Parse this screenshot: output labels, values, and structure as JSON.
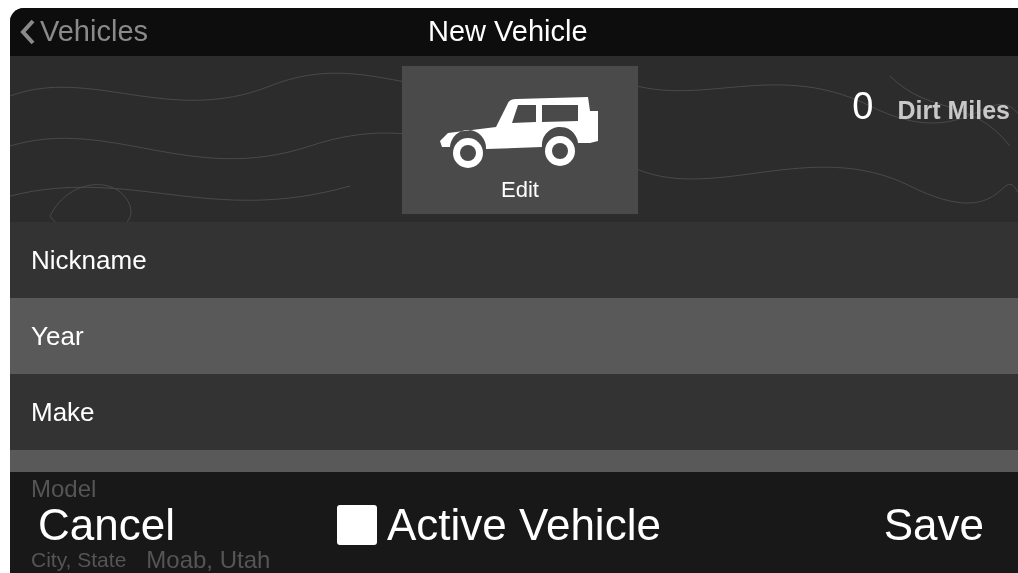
{
  "nav_bar": {
    "back_label": "Vehicles",
    "title": "New Vehicle"
  },
  "header": {
    "photo_button_label": "Edit",
    "dirt_miles_value": "0",
    "dirt_miles_label": "Dirt Miles"
  },
  "fields": [
    {
      "label": "Nickname"
    },
    {
      "label": "Year"
    },
    {
      "label": "Make"
    },
    {
      "label": "Model"
    },
    {
      "label": "City, State",
      "value": "Moab, Utah"
    }
  ],
  "toolbar": {
    "cancel": "Cancel",
    "active_vehicle": {
      "label": "Active Vehicle",
      "checked": false
    },
    "save": "Save"
  }
}
